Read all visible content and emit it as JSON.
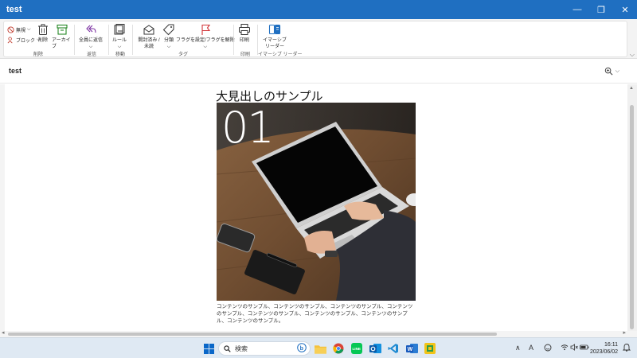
{
  "window": {
    "title": "test",
    "minimize_glyph": "—",
    "restore_glyph": "❐",
    "close_glyph": "✕"
  },
  "ribbon": {
    "delete_group": {
      "label": "削除",
      "ignore_label": "無視",
      "block_label": "ブロック",
      "delete_label": "削除",
      "archive_label": "アーカイブ"
    },
    "respond_group": {
      "label": "返信",
      "reply_all_label": "全員に返信"
    },
    "move_group": {
      "label": "移動",
      "rules_label": "ルール"
    },
    "tags_group": {
      "label": "タグ",
      "read_unread_label": "開封済み / 未読",
      "categorize_label": "分類",
      "flag_label": "フラグを設定/フラグを解除"
    },
    "print_group": {
      "label": "印刷",
      "print_label": "印刷"
    },
    "immersive_group": {
      "label": "イマーシブ リーダー",
      "immersive_label": "イマーシブ リーダー"
    }
  },
  "message": {
    "subject": "test",
    "heading": "大見出しのサンプル",
    "image_number": "01",
    "body": "コンテンツのサンプル、コンテンツのサンプル、コンテンツのサンプル、コンテンツのサンプル、コンテンツのサンプル、コンテンツのサンプル、コンテンツのサンプル、コンテンツのサンプル。"
  },
  "taskbar": {
    "search_placeholder": "検索",
    "time": "16:11",
    "date": "2023/06/02",
    "ime_label": "A"
  },
  "colors": {
    "titlebar": "#1f6fc1",
    "taskbar": "#dfe9f3",
    "flag_red": "#d13438",
    "archive_green": "#107c10",
    "reply_purple": "#7a2ea0"
  }
}
